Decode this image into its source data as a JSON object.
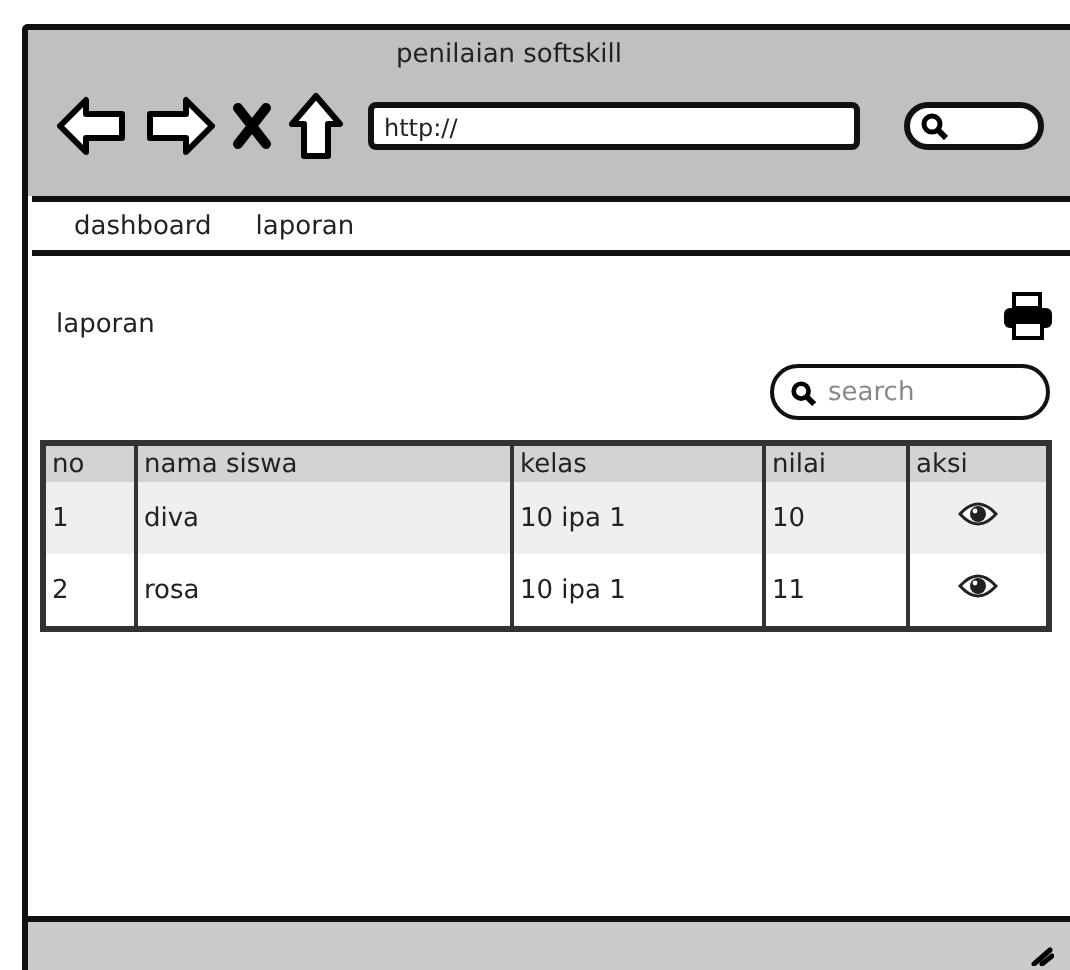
{
  "window": {
    "title": "penilaian softskill"
  },
  "address_bar": {
    "value": "http://"
  },
  "nav": {
    "items": [
      {
        "label": "dashboard"
      },
      {
        "label": "laporan"
      }
    ]
  },
  "page": {
    "heading": "laporan"
  },
  "search": {
    "placeholder": "search"
  },
  "table": {
    "columns": [
      "no",
      "nama siswa",
      "kelas",
      "nilai",
      "aksi"
    ],
    "rows": [
      {
        "no": "1",
        "nama_siswa": "diva",
        "kelas": "10 ipa 1",
        "nilai": "10"
      },
      {
        "no": "2",
        "nama_siswa": "rosa",
        "kelas": "10 ipa 1",
        "nilai": "11"
      }
    ]
  }
}
